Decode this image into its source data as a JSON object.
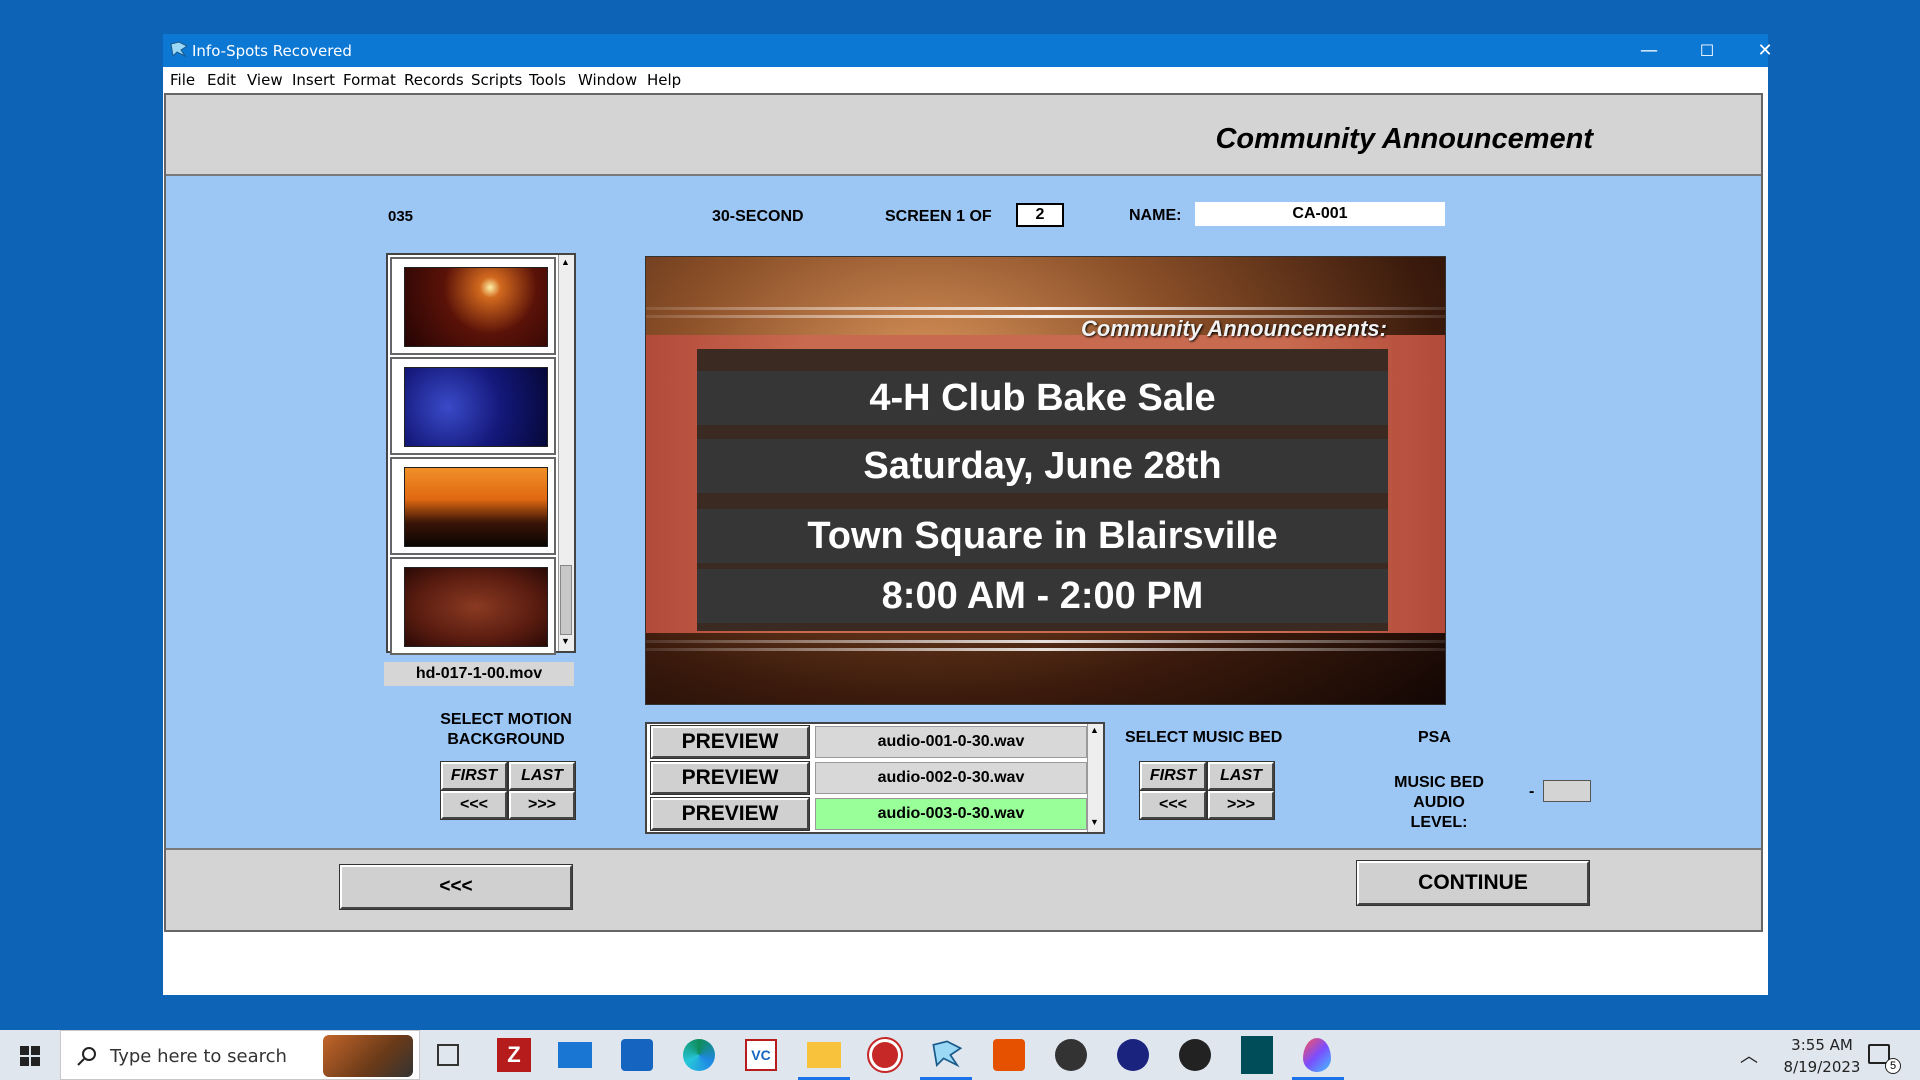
{
  "window": {
    "title": "Info-Spots Recovered",
    "controls": {
      "minimize": "—",
      "maximize": "☐",
      "close": "✕"
    }
  },
  "menu": [
    "File",
    "Edit",
    "View",
    "Insert",
    "Format",
    "Records",
    "Scripts",
    "Tools",
    "Window",
    "Help"
  ],
  "header": {
    "title": "Community Announcement"
  },
  "info": {
    "record_number": "035",
    "duration": "30-SECOND",
    "screen_label": "SCREEN 1 OF",
    "screen_total": "2",
    "name_label": "NAME:",
    "name_value": "CA-001"
  },
  "background": {
    "thumbnails": [
      "red-backdrop",
      "blue-backdrop",
      "sunset-backdrop",
      "maroon-backdrop"
    ],
    "selected_file": "hd-017-1-00.mov",
    "select_label": "SELECT MOTION\nBACKGROUND",
    "nav": {
      "first": "FIRST",
      "last": "LAST",
      "prev": "<<<",
      "next": ">>>"
    }
  },
  "preview": {
    "header": "Community Announcements:",
    "lines": [
      "4-H Club Bake Sale",
      "Saturday, June 28th",
      "Town Square in Blairsville",
      "8:00 AM - 2:00 PM"
    ]
  },
  "audio": {
    "rows": [
      {
        "button": "PREVIEW",
        "file": "audio-001-0-30.wav"
      },
      {
        "button": "PREVIEW",
        "file": "audio-002-0-30.wav"
      },
      {
        "button": "PREVIEW",
        "file": "audio-003-0-30.wav"
      }
    ],
    "selected_index": 2,
    "selected_color": "#99ff99",
    "select_label": "SELECT MUSIC BED",
    "nav": {
      "first": "FIRST",
      "last": "LAST",
      "prev": "<<<",
      "next": ">>>"
    },
    "psa_label": "PSA",
    "level_label": "MUSIC BED\nAUDIO LEVEL:",
    "level_dash": "-",
    "level_value": ""
  },
  "footer": {
    "back": "<<<",
    "continue": "CONTINUE"
  },
  "taskbar": {
    "search_placeholder": "Type here to search",
    "time": "3:55 AM",
    "date": "8/19/2023",
    "notification_count": "5"
  },
  "colors": {
    "desktop": "#0d63b6",
    "titlebar": "#0c78d4",
    "panel": "#9cc6f4",
    "header": "#d4d4d4"
  }
}
